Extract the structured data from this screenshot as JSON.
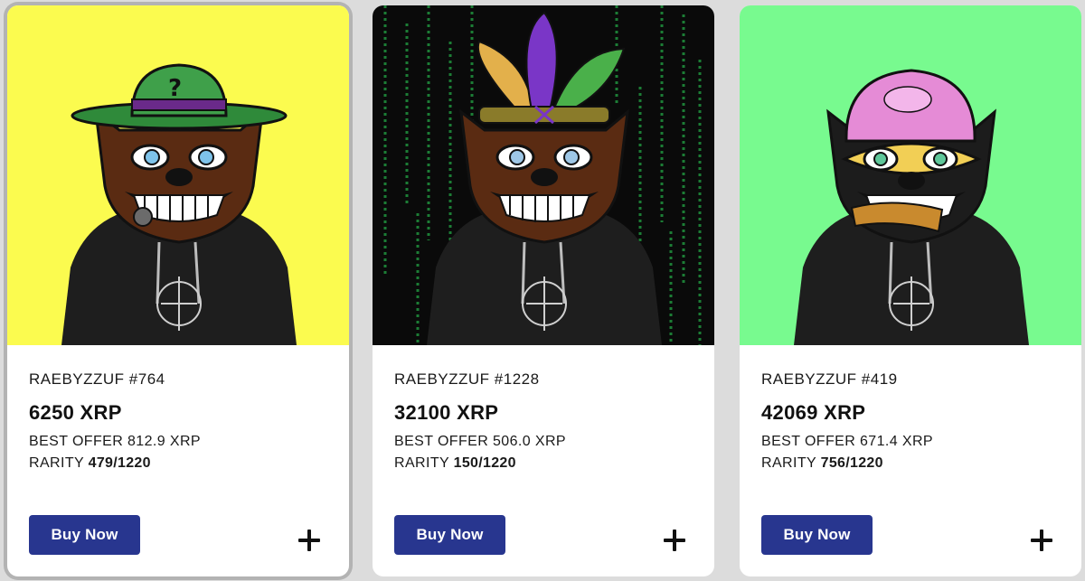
{
  "cards": [
    {
      "name": "RAEBYZZUF #764",
      "price": "6250 XRP",
      "best_offer": "BEST OFFER 812.9 XRP",
      "rarity_label": "RARITY",
      "rarity_value": "479/1220",
      "buy_label": "Buy Now",
      "background": "#fbfb4f",
      "fur": "#5a2b12",
      "accessory": "green bowler hat with question mark",
      "selected": true
    },
    {
      "name": "RAEBYZZUF #1228",
      "price": "32100 XRP",
      "best_offer": "BEST OFFER 506.0 XRP",
      "rarity_label": "RARITY",
      "rarity_value": "150/1220",
      "buy_label": "Buy Now",
      "background": "#0a0a0a",
      "fur": "#5a2b12",
      "accessory": "feather headdress",
      "selected": false
    },
    {
      "name": "RAEBYZZUF #419",
      "price": "42069 XRP",
      "best_offer": "BEST OFFER 671.4 XRP",
      "rarity_label": "RARITY",
      "rarity_value": "756/1220",
      "buy_label": "Buy Now",
      "background": "#78fa8f",
      "fur": "#1c1c1c",
      "accessory": "pink cap with mask",
      "selected": false
    }
  ],
  "icons": {
    "add": "plus-icon"
  }
}
